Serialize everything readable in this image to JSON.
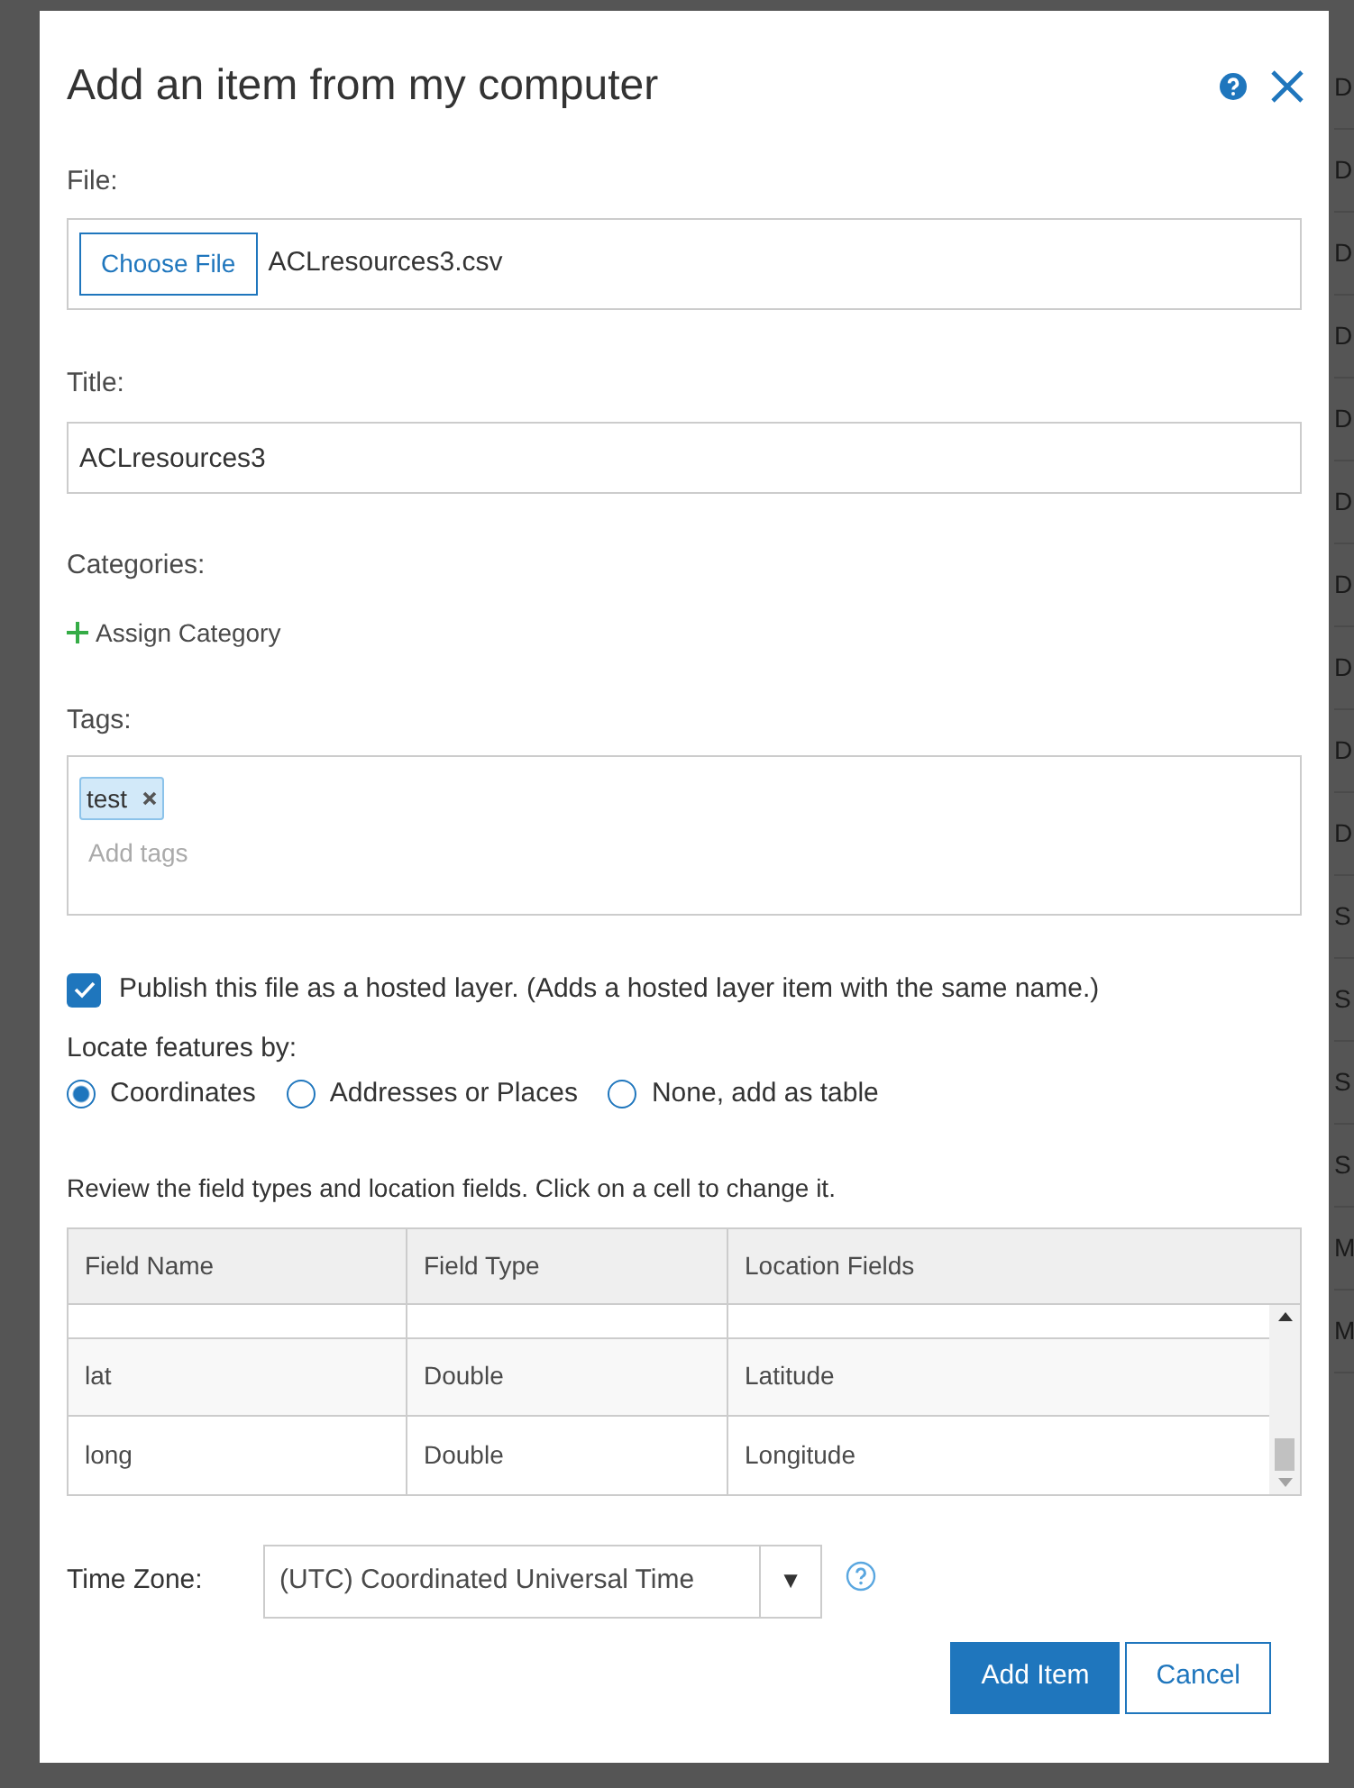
{
  "backdrop": {
    "rows": [
      "D",
      "D",
      "D",
      "D",
      "D",
      "D",
      "D",
      "D",
      "D",
      "D",
      "S",
      "S",
      "S",
      "S",
      "M",
      "M"
    ]
  },
  "dialog": {
    "title": "Add an item from my computer"
  },
  "file": {
    "label": "File:",
    "button": "Choose File",
    "value": "ACLresources3.csv"
  },
  "title_field": {
    "label": "Title:",
    "value": "ACLresources3"
  },
  "categories": {
    "label": "Categories:",
    "action": "Assign Category"
  },
  "tags": {
    "label": "Tags:",
    "items": [
      {
        "text": "test"
      }
    ],
    "placeholder": "Add tags"
  },
  "publish": {
    "label": "Publish this file as a hosted layer. (Adds a hosted layer item with the same name.)",
    "checked": true
  },
  "locate": {
    "label": "Locate features by:",
    "options": [
      {
        "label": "Coordinates",
        "selected": true
      },
      {
        "label": "Addresses or Places",
        "selected": false
      },
      {
        "label": "None, add as table",
        "selected": false
      }
    ]
  },
  "table": {
    "hint": "Review the field types and location fields. Click on a cell to change it.",
    "columns": [
      "Field Name",
      "Field Type",
      "Location Fields"
    ],
    "rows": [
      [
        "lat",
        "Double",
        "Latitude"
      ],
      [
        "long",
        "Double",
        "Longitude"
      ]
    ]
  },
  "time_zone": {
    "label": "Time Zone:",
    "value": "(UTC) Coordinated Universal Time",
    "caret": "▼"
  },
  "buttons": [
    {
      "label": "Add Item",
      "kind": "primary"
    },
    {
      "label": "Cancel",
      "kind": "secondary"
    }
  ]
}
